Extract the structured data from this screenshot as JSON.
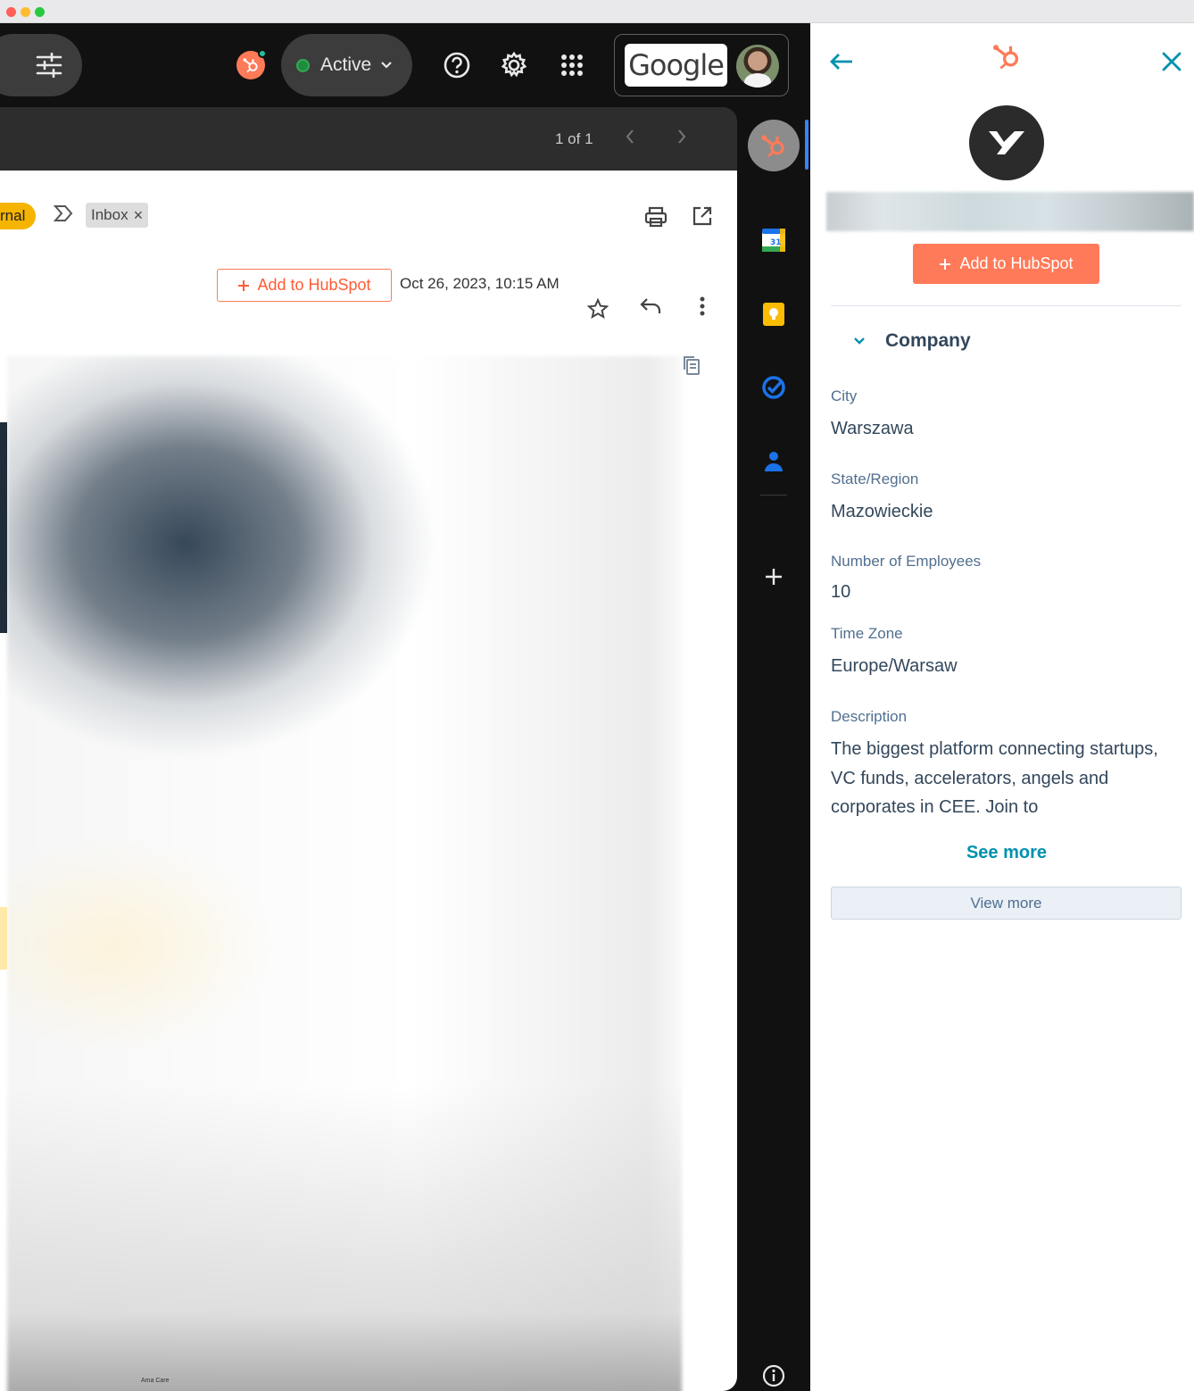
{
  "window": {
    "traffic_lights": [
      "#ff5f57",
      "#febc2e",
      "#28c840"
    ]
  },
  "topbar": {
    "status_label": "Active",
    "google_wordmark": "Google"
  },
  "mail_toolbar": {
    "pagination": "1 of 1"
  },
  "message": {
    "label_partial": "rnal",
    "inbox_label": "Inbox",
    "inbox_remove": "×",
    "add_to_hubspot": "Add to HubSpot",
    "date": "Oct 26, 2023, 10:15 AM",
    "footer_snippet": "Ama Care"
  },
  "hubspot_panel": {
    "add_to_hubspot": "Add to HubSpot",
    "section_title": "Company",
    "properties": [
      {
        "label": "City",
        "value": "Warszawa"
      },
      {
        "label": "State/Region",
        "value": "Mazowieckie"
      },
      {
        "label": "Number of Employees",
        "value": "10"
      },
      {
        "label": "Time Zone",
        "value": "Europe/Warsaw"
      },
      {
        "label": "Description",
        "value": "The biggest platform connecting startups, VC funds, accelerators, angels and corporates in CEE. Join to"
      }
    ],
    "see_more": "See more",
    "view_more": "View more"
  },
  "colors": {
    "hubspot_orange": "#ff7a59",
    "hubspot_teal": "#0091ae",
    "status_green": "#34a853",
    "gmail_dark": "#111111"
  },
  "icons": [
    "filter-sliders-icon",
    "hubspot-status-icon",
    "help-icon",
    "settings-gear-icon",
    "apps-grid-icon",
    "print-icon",
    "open-in-new-window-icon",
    "star-icon",
    "reply-icon",
    "more-vertical-icon",
    "copy-icon",
    "calendar-icon",
    "keep-icon",
    "tasks-icon",
    "contacts-icon",
    "add-icon",
    "info-icon",
    "back-arrow-icon",
    "sprocket-icon",
    "close-icon",
    "chevron-down-icon"
  ]
}
